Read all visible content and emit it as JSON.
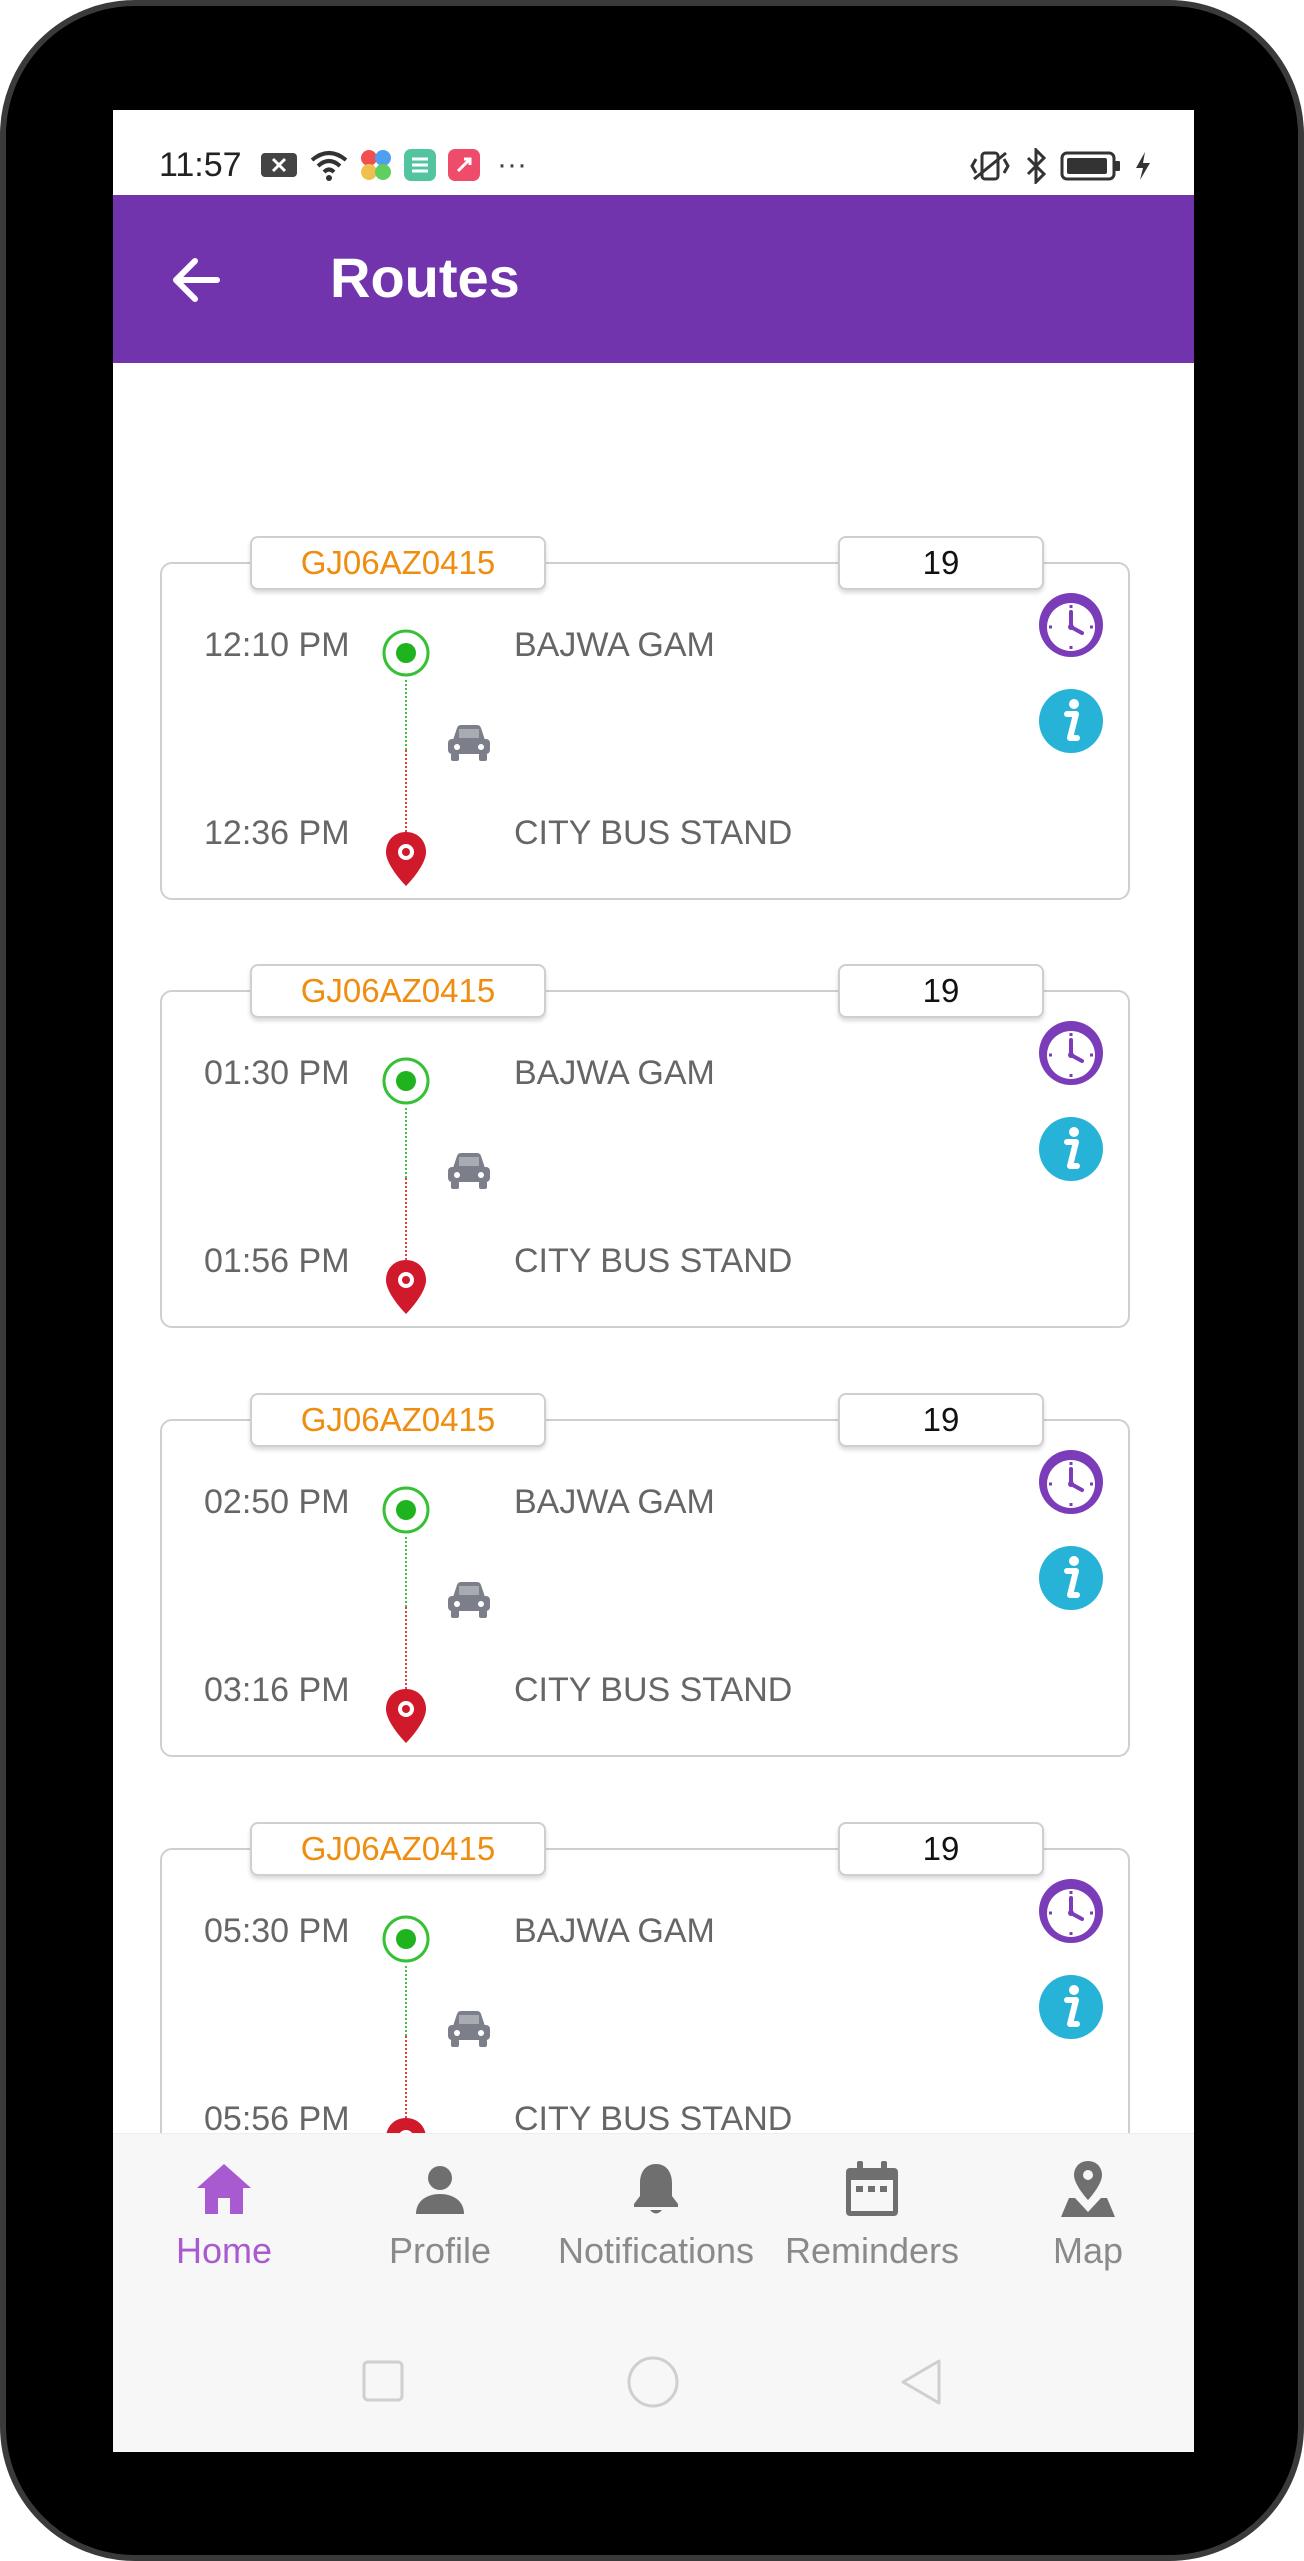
{
  "status_bar": {
    "time": "11:57",
    "more": "···"
  },
  "header": {
    "title": "Routes"
  },
  "routes": [
    {
      "plate": "GJ06AZ0415",
      "route_no": "19",
      "dep_time": "12:10 PM",
      "dep_stop": "BAJWA GAM",
      "arr_time": "12:36 PM",
      "arr_stop": "CITY BUS STAND"
    },
    {
      "plate": "GJ06AZ0415",
      "route_no": "19",
      "dep_time": "01:30 PM",
      "dep_stop": "BAJWA GAM",
      "arr_time": "01:56 PM",
      "arr_stop": "CITY BUS STAND"
    },
    {
      "plate": "GJ06AZ0415",
      "route_no": "19",
      "dep_time": "02:50 PM",
      "dep_stop": "BAJWA GAM",
      "arr_time": "03:16 PM",
      "arr_stop": "CITY BUS STAND"
    },
    {
      "plate": "GJ06AZ0415",
      "route_no": "19",
      "dep_time": "05:30 PM",
      "dep_stop": "BAJWA GAM",
      "arr_time": "05:56 PM",
      "arr_stop": "CITY BUS STAND"
    }
  ],
  "bottom_nav": {
    "items": [
      {
        "label": "Home",
        "icon": "home-icon",
        "active": true
      },
      {
        "label": "Profile",
        "icon": "person-icon",
        "active": false
      },
      {
        "label": "Notifications",
        "icon": "bell-icon",
        "active": false
      },
      {
        "label": "Reminders",
        "icon": "calendar-icon",
        "active": false
      },
      {
        "label": "Map",
        "icon": "map-pin-icon",
        "active": false
      }
    ]
  },
  "colors": {
    "app_bar": "#7234ac",
    "plate_text": "#ee8d10",
    "active_nav": "#a95ad1",
    "info_icon": "#27b3d8",
    "clock_icon": "#7a3cb8",
    "start_dot": "#35c135",
    "end_pin": "#d0192a"
  }
}
